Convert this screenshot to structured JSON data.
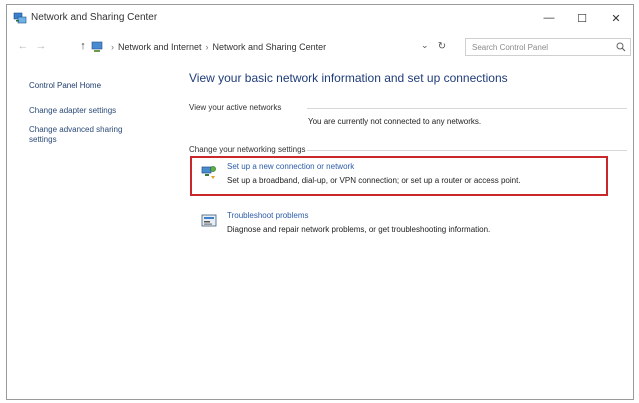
{
  "window": {
    "title": "Network and Sharing Center",
    "controls": {
      "minimize": "—",
      "maximize": "☐",
      "close": "✕"
    }
  },
  "address": {
    "back": "←",
    "forward": "→",
    "up": "↑",
    "separator": "›",
    "crumbs": [
      "Network and Internet",
      "Network and Sharing Center"
    ],
    "dropdown": "⌄",
    "refresh": "↻",
    "search_placeholder": "Search Control Panel"
  },
  "sidebar": {
    "home": "Control Panel Home",
    "items": [
      "Change adapter settings",
      "Change advanced sharing settings"
    ]
  },
  "main": {
    "heading": "View your basic network information and set up connections",
    "active_label": "View your active networks",
    "no_network": "You are currently not connected to any networks.",
    "settings_label": "Change your networking settings",
    "tasks": [
      {
        "title": "Set up a new connection or network",
        "description": "Set up a broadband, dial-up, or VPN connection; or set up a router or access point.",
        "icon": "new-connection-icon"
      },
      {
        "title": "Troubleshoot problems",
        "description": "Diagnose and repair network problems, or get troubleshooting information.",
        "icon": "troubleshoot-icon"
      }
    ]
  },
  "colors": {
    "link": "#2c5ca8",
    "heading": "#1f3c7a",
    "highlight": "#c8282c"
  }
}
